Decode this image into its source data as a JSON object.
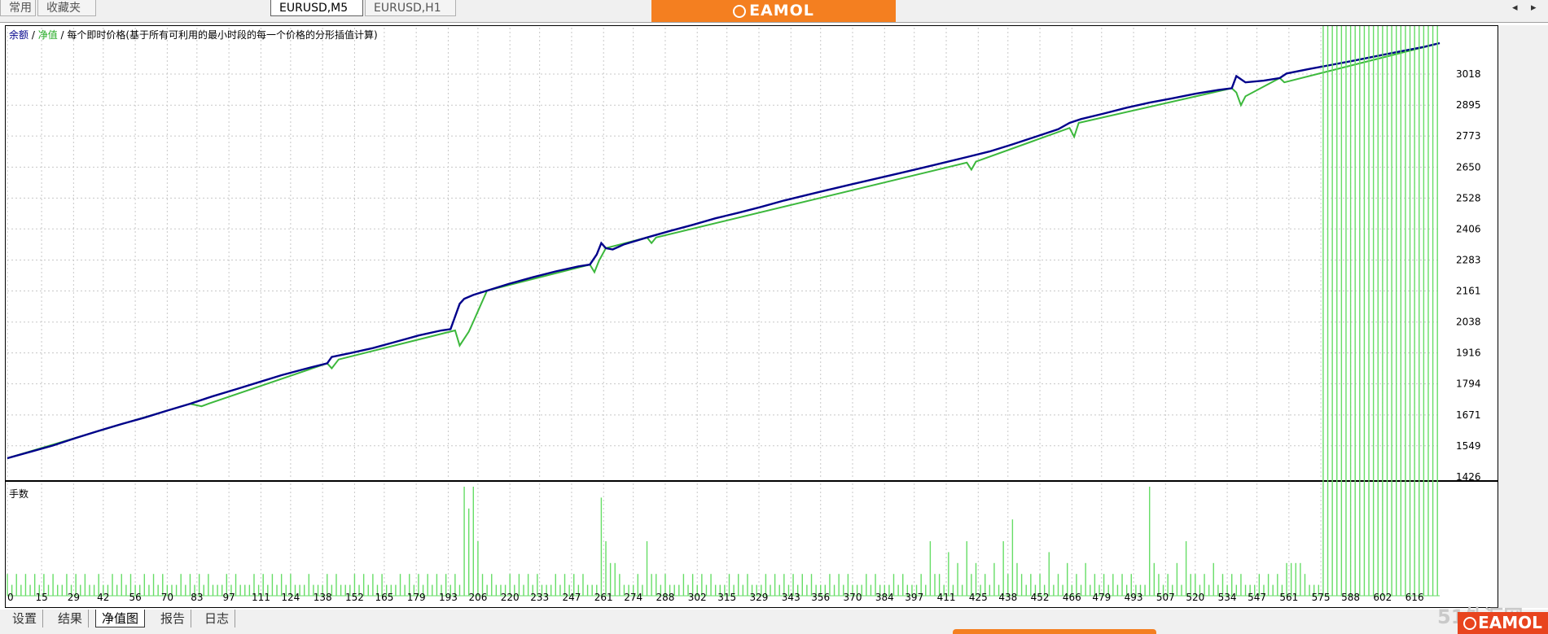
{
  "top_tabs": {
    "common": "常用",
    "favorites": "收藏夹",
    "eurusd_m5": "EURUSD,M5",
    "eurusd_h1": "EURUSD,H1"
  },
  "brand": "EAMOL",
  "nav": {
    "scroll_left": "◂",
    "scroll_right": "▸"
  },
  "legend": {
    "balance": "余额",
    "sep1": " / ",
    "equity": "净值",
    "sep2": " / ",
    "description": "每个即时价格(基于所有可利用的最小时段的每一个价格的分形插值计算)"
  },
  "colors": {
    "balance": "#00008b",
    "equity": "#3cb83c",
    "volume_bar": "#66dd66",
    "grid": "#c8c8c8"
  },
  "chart_data": {
    "type": "line",
    "xlabel": "",
    "ylabel": "",
    "ylim": [
      1426,
      3079
    ],
    "y_ticks": [
      3018,
      2895,
      2773,
      2650,
      2528,
      2406,
      2283,
      2161,
      2038,
      1916,
      1794,
      1671,
      1549,
      1426
    ],
    "x_ticks": [
      0,
      15,
      29,
      42,
      56,
      70,
      83,
      97,
      111,
      124,
      138,
      152,
      165,
      179,
      193,
      206,
      220,
      233,
      247,
      261,
      274,
      288,
      302,
      315,
      329,
      343,
      356,
      370,
      384,
      397,
      411,
      425,
      438,
      452,
      466,
      479,
      493,
      507,
      520,
      534,
      547,
      561,
      575,
      588,
      602,
      616
    ],
    "xlim": [
      0,
      627
    ],
    "grid": true,
    "series": [
      {
        "name": "余额",
        "x": [
          0,
          10,
          20,
          30,
          40,
          50,
          60,
          70,
          80,
          90,
          100,
          110,
          120,
          130,
          140,
          142,
          150,
          160,
          170,
          180,
          190,
          194,
          196,
          198,
          200,
          204,
          210,
          220,
          230,
          240,
          250,
          255,
          258,
          260,
          262,
          265,
          270,
          280,
          290,
          300,
          310,
          320,
          330,
          340,
          350,
          360,
          370,
          380,
          390,
          400,
          410,
          420,
          430,
          440,
          450,
          460,
          465,
          470,
          480,
          490,
          500,
          510,
          520,
          530,
          536,
          538,
          542,
          550,
          557,
          560,
          570,
          580,
          590,
          600,
          610,
          620,
          627
        ],
        "y": [
          1500,
          1525,
          1550,
          1580,
          1608,
          1635,
          1660,
          1688,
          1715,
          1745,
          1772,
          1800,
          1828,
          1852,
          1875,
          1900,
          1915,
          1935,
          1960,
          1985,
          2005,
          2010,
          2060,
          2110,
          2130,
          2145,
          2162,
          2190,
          2215,
          2238,
          2258,
          2265,
          2305,
          2350,
          2330,
          2325,
          2345,
          2372,
          2398,
          2422,
          2448,
          2470,
          2493,
          2518,
          2540,
          2562,
          2583,
          2604,
          2625,
          2646,
          2668,
          2690,
          2712,
          2740,
          2770,
          2800,
          2825,
          2840,
          2862,
          2885,
          2905,
          2922,
          2940,
          2955,
          2962,
          3010,
          2985,
          2992,
          3002,
          3020,
          3038,
          3055,
          3072,
          3090,
          3108,
          3125,
          3140
        ]
      },
      {
        "name": "净值",
        "x": [
          0,
          80,
          85,
          88,
          140,
          142,
          145,
          196,
          198,
          202,
          204,
          210,
          255,
          257,
          259,
          262,
          280,
          282,
          284,
          420,
          422,
          424,
          465,
          467,
          469,
          536,
          538,
          540,
          542,
          557,
          559,
          627
        ],
        "y": [
          1500,
          1715,
          1705,
          1715,
          1875,
          1855,
          1890,
          2005,
          1945,
          2000,
          2040,
          2162,
          2265,
          2235,
          2280,
          2330,
          2372,
          2350,
          2372,
          2668,
          2640,
          2672,
          2805,
          2770,
          2825,
          2962,
          2945,
          2895,
          2930,
          3002,
          2985,
          3140
        ]
      }
    ],
    "volume_panel": {
      "label": "手数",
      "x": [
        0,
        2,
        4,
        6,
        8,
        10,
        12,
        14,
        16,
        18,
        20,
        22,
        24,
        26,
        28,
        30,
        32,
        34,
        36,
        38,
        40,
        42,
        44,
        46,
        48,
        50,
        52,
        54,
        56,
        58,
        60,
        62,
        64,
        66,
        68,
        70,
        72,
        74,
        76,
        78,
        80,
        82,
        84,
        86,
        88,
        90,
        92,
        94,
        96,
        98,
        100,
        102,
        104,
        106,
        108,
        110,
        112,
        114,
        116,
        118,
        120,
        122,
        124,
        126,
        128,
        130,
        132,
        134,
        136,
        138,
        140,
        142,
        144,
        146,
        148,
        150,
        152,
        154,
        156,
        158,
        160,
        162,
        164,
        166,
        168,
        170,
        172,
        174,
        176,
        178,
        180,
        182,
        184,
        186,
        188,
        190,
        192,
        194,
        196,
        198,
        200,
        202,
        204,
        206,
        208,
        210,
        212,
        214,
        216,
        218,
        220,
        222,
        224,
        226,
        228,
        230,
        232,
        234,
        236,
        238,
        240,
        242,
        244,
        246,
        248,
        250,
        252,
        254,
        256,
        258,
        260,
        262,
        264,
        266,
        268,
        270,
        272,
        274,
        276,
        278,
        280,
        282,
        284,
        286,
        288,
        290,
        292,
        294,
        296,
        298,
        300,
        302,
        304,
        306,
        308,
        310,
        312,
        314,
        316,
        318,
        320,
        322,
        324,
        326,
        328,
        330,
        332,
        334,
        336,
        338,
        340,
        342,
        344,
        346,
        348,
        350,
        352,
        354,
        356,
        358,
        360,
        362,
        364,
        366,
        368,
        370,
        372,
        374,
        376,
        378,
        380,
        382,
        384,
        386,
        388,
        390,
        392,
        394,
        396,
        398,
        400,
        402,
        404,
        406,
        408,
        410,
        412,
        414,
        416,
        418,
        420,
        422,
        424,
        426,
        428,
        430,
        432,
        434,
        436,
        438,
        440,
        442,
        444,
        446,
        448,
        450,
        452,
        454,
        456,
        458,
        460,
        462,
        464,
        466,
        468,
        470,
        472,
        474,
        476,
        478,
        480,
        482,
        484,
        486,
        488,
        490,
        492,
        494,
        496,
        498,
        500,
        502,
        504,
        506,
        508,
        510,
        512,
        514,
        516,
        518,
        520,
        522,
        524,
        526,
        528,
        530,
        532,
        534,
        536,
        538,
        540,
        542,
        544,
        546,
        548,
        550,
        552,
        554,
        556,
        558,
        560,
        562,
        564,
        566,
        568,
        570,
        572,
        574,
        576,
        578,
        580,
        582,
        584,
        586,
        588,
        590,
        592,
        594,
        596,
        598,
        600,
        602,
        604,
        606,
        608,
        610,
        612,
        614,
        616,
        618,
        620,
        622,
        624,
        626
      ],
      "values": [
        0.2,
        0.1,
        0.2,
        0.1,
        0.2,
        0.1,
        0.2,
        0.1,
        0.2,
        0.1,
        0.2,
        0.1,
        0.1,
        0.2,
        0.1,
        0.2,
        0.1,
        0.2,
        0.1,
        0.1,
        0.2,
        0.1,
        0.1,
        0.2,
        0.1,
        0.2,
        0.1,
        0.2,
        0.1,
        0.1,
        0.2,
        0.1,
        0.2,
        0.1,
        0.2,
        0.1,
        0.1,
        0.1,
        0.2,
        0.1,
        0.2,
        0.1,
        0.2,
        0.1,
        0.2,
        0.1,
        0.1,
        0.1,
        0.2,
        0.1,
        0.2,
        0.1,
        0.1,
        0.1,
        0.2,
        0.1,
        0.2,
        0.1,
        0.2,
        0.1,
        0.2,
        0.1,
        0.2,
        0.1,
        0.1,
        0.1,
        0.2,
        0.1,
        0.1,
        0.1,
        0.2,
        0.1,
        0.2,
        0.1,
        0.1,
        0.1,
        0.2,
        0.1,
        0.2,
        0.1,
        0.2,
        0.1,
        0.2,
        0.1,
        0.1,
        0.1,
        0.2,
        0.1,
        0.2,
        0.1,
        0.2,
        0.1,
        0.2,
        0.1,
        0.2,
        0.1,
        0.2,
        0.1,
        0.2,
        0.1,
        1.0,
        0.8,
        1.0,
        0.5,
        0.2,
        0.1,
        0.2,
        0.1,
        0.1,
        0.1,
        0.2,
        0.1,
        0.2,
        0.1,
        0.2,
        0.1,
        0.2,
        0.1,
        0.1,
        0.1,
        0.2,
        0.1,
        0.2,
        0.1,
        0.2,
        0.1,
        0.2,
        0.1,
        0.1,
        0.1,
        0.9,
        0.5,
        0.3,
        0.3,
        0.2,
        0.1,
        0.1,
        0.1,
        0.2,
        0.1,
        0.5,
        0.2,
        0.2,
        0.1,
        0.2,
        0.1,
        0.1,
        0.1,
        0.2,
        0.1,
        0.2,
        0.1,
        0.2,
        0.1,
        0.2,
        0.1,
        0.1,
        0.1,
        0.2,
        0.1,
        0.2,
        0.1,
        0.2,
        0.1,
        0.1,
        0.1,
        0.2,
        0.1,
        0.2,
        0.1,
        0.2,
        0.1,
        0.2,
        0.1,
        0.2,
        0.1,
        0.2,
        0.1,
        0.1,
        0.1,
        0.2,
        0.1,
        0.2,
        0.1,
        0.2,
        0.1,
        0.1,
        0.1,
        0.2,
        0.1,
        0.2,
        0.1,
        0.1,
        0.1,
        0.2,
        0.1,
        0.2,
        0.1,
        0.1,
        0.1,
        0.2,
        0.1,
        0.5,
        0.2,
        0.2,
        0.1,
        0.4,
        0.1,
        0.3,
        0.1,
        0.5,
        0.2,
        0.3,
        0.1,
        0.2,
        0.1,
        0.3,
        0.1,
        0.5,
        0.2,
        0.7,
        0.3,
        0.2,
        0.1,
        0.2,
        0.1,
        0.2,
        0.1,
        0.4,
        0.1,
        0.2,
        0.1,
        0.3,
        0.1,
        0.2,
        0.1,
        0.3,
        0.1,
        0.2,
        0.1,
        0.2,
        0.1,
        0.2,
        0.1,
        0.2,
        0.1,
        0.2,
        0.1,
        0.1,
        0.1,
        1.0,
        0.3,
        0.2,
        0.1,
        0.2,
        0.1,
        0.3,
        0.1,
        0.5,
        0.2,
        0.2,
        0.1,
        0.2,
        0.1,
        0.3,
        0.1,
        0.2,
        0.1,
        0.2,
        0.1,
        0.2,
        0.1,
        0.1,
        0.1,
        0.2,
        0.1,
        0.2,
        0.1,
        0.2,
        0.1,
        0.3,
        0.3,
        0.3,
        0.3,
        0.2,
        0.1,
        0.1,
        0.1
      ]
    }
  },
  "bottom_tabs": [
    "设置",
    "结果",
    "净值图",
    "报告",
    "日志"
  ],
  "bottom_tabs_active": 2,
  "watermark": "51外汇网"
}
